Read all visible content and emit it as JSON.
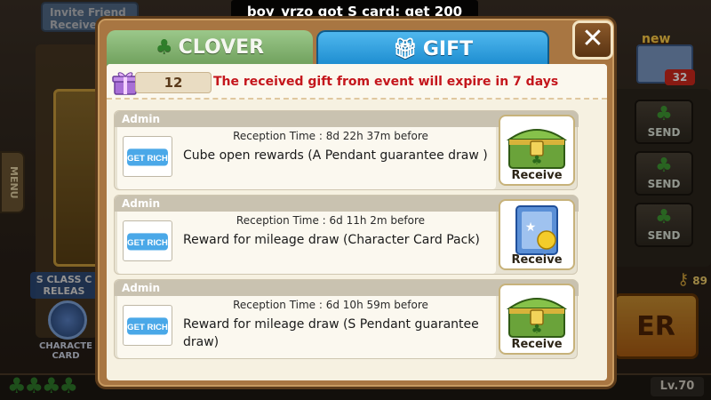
{
  "ticker": {
    "text": "boy_vrzo got S card: get 200"
  },
  "background": {
    "invite_label": "Invite Friend Receive",
    "menu_label": "MENU",
    "s_class_label": "S CLASS C RELEAS",
    "character_card_label": "CHARACTE CARD",
    "mail_new_label": "new",
    "mail_count": "32",
    "send_label": "SEND",
    "key_count": "89",
    "level_label": "Lv.70",
    "play_label": "ER"
  },
  "modal": {
    "tabs": [
      {
        "label": "CLOVER",
        "icon": "clover-icon",
        "active": false
      },
      {
        "label": "GIFT",
        "icon": "gift-icon",
        "active": true
      }
    ],
    "close_label": "✕",
    "gift_count": "12",
    "expire_notice": "The received gift from event will expire in 7 days",
    "receive_label": "Receive",
    "items": [
      {
        "sender": "Admin",
        "reception_time": "Reception Time : 8d 22h 37m before",
        "description": "Cube open rewards (A Pendant guarantee draw )",
        "reward_icon": "treasure-chest-icon"
      },
      {
        "sender": "Admin",
        "reception_time": "Reception Time : 6d 11h 2m before",
        "description": "Reward for mileage draw (Character Card Pack)",
        "reward_icon": "card-pack-icon"
      },
      {
        "sender": "Admin",
        "reception_time": "Reception Time : 6d 10h 59m before",
        "description": "Reward for mileage draw (S Pendant guarantee draw)",
        "reward_icon": "treasure-chest-icon"
      }
    ]
  },
  "colors": {
    "gift_tab": "#1c8ccf",
    "expire_text": "#c4161c",
    "modal_frame": "#a87642"
  }
}
